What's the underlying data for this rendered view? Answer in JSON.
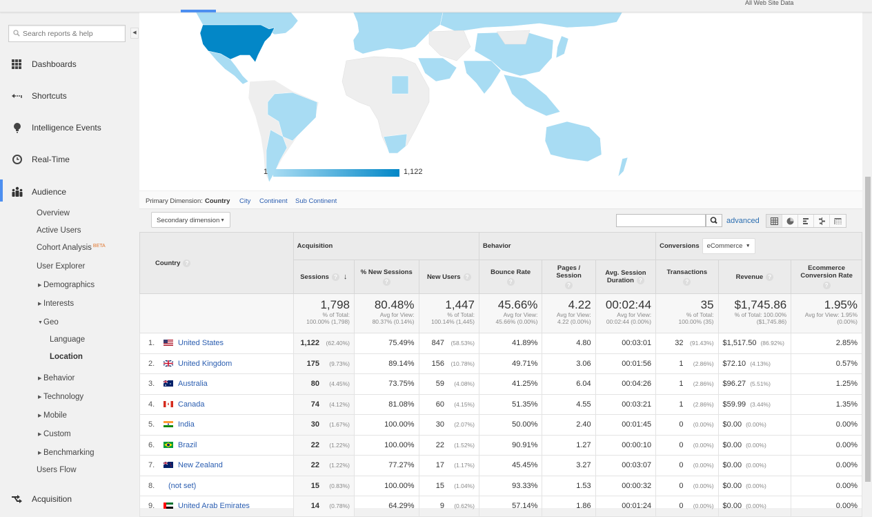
{
  "header": {
    "view_name": "All Web Site Data"
  },
  "sidebar": {
    "search_placeholder": "Search reports & help",
    "main_items": [
      {
        "label": "Dashboards",
        "icon": "grid-icon"
      },
      {
        "label": "Shortcuts",
        "icon": "shortcut-arrow-icon"
      },
      {
        "label": "Intelligence Events",
        "icon": "lightbulb-icon"
      },
      {
        "label": "Real-Time",
        "icon": "clock-icon"
      },
      {
        "label": "Audience",
        "icon": "people-icon",
        "active": true
      },
      {
        "label": "Acquisition",
        "icon": "acquisition-arrows-icon"
      }
    ],
    "audience_items": [
      {
        "label": "Overview"
      },
      {
        "label": "Active Users"
      },
      {
        "label": "Cohort Analysis",
        "badge": "BETA"
      },
      {
        "label": "User Explorer"
      },
      {
        "label": "Demographics",
        "caret": "right"
      },
      {
        "label": "Interests",
        "caret": "right"
      },
      {
        "label": "Geo",
        "caret": "down"
      },
      {
        "label": "Language",
        "level": 2
      },
      {
        "label": "Location",
        "level": 2,
        "selected": true
      },
      {
        "label": "Behavior",
        "caret": "right"
      },
      {
        "label": "Technology",
        "caret": "right"
      },
      {
        "label": "Mobile",
        "caret": "right"
      },
      {
        "label": "Custom",
        "caret": "right"
      },
      {
        "label": "Benchmarking",
        "caret": "right"
      },
      {
        "label": "Users Flow"
      }
    ]
  },
  "map": {
    "legend_min": "1",
    "legend_max": "1,122",
    "color_low": "#a8dcf3",
    "color_high": "#0387c7"
  },
  "primary_dimension": {
    "label": "Primary Dimension:",
    "current": "Country",
    "options": [
      "City",
      "Continent",
      "Sub Continent"
    ]
  },
  "toolbar": {
    "secondary_dimension": "Secondary dimension",
    "filter_value": "",
    "advanced_label": "advanced",
    "view_buttons": [
      "table-view",
      "pie-view",
      "performance-view",
      "comparison-view",
      "pivot-view"
    ]
  },
  "table": {
    "dimension_header": "Country",
    "groups": {
      "acquisition": "Acquisition",
      "behavior": "Behavior",
      "conversions": "Conversions",
      "conversions_select": "eCommerce"
    },
    "columns": [
      "Sessions",
      "% New Sessions",
      "New Users",
      "Bounce Rate",
      "Pages / Session",
      "Avg. Session Duration",
      "Transactions",
      "Revenue",
      "Ecommerce Conversion Rate"
    ],
    "totals": [
      {
        "value": "1,798",
        "sub1": "% of Total:",
        "sub2": "100.00% (1,798)"
      },
      {
        "value": "80.48%",
        "sub1": "Avg for View:",
        "sub2": "80.37% (0.14%)"
      },
      {
        "value": "1,447",
        "sub1": "% of Total:",
        "sub2": "100.14% (1,445)"
      },
      {
        "value": "45.66%",
        "sub1": "Avg for View:",
        "sub2": "45.66% (0.00%)"
      },
      {
        "value": "4.22",
        "sub1": "Avg for View:",
        "sub2": "4.22 (0.00%)"
      },
      {
        "value": "00:02:44",
        "sub1": "Avg for View:",
        "sub2": "00:02:44 (0.00%)"
      },
      {
        "value": "35",
        "sub1": "% of Total:",
        "sub2": "100.00% (35)"
      },
      {
        "value": "$1,745.86",
        "sub1": "% of Total: 100.00%",
        "sub2": "($1,745.86)"
      },
      {
        "value": "1.95%",
        "sub1": "Avg for View: 1.95%",
        "sub2": "(0.00%)"
      }
    ],
    "rows": [
      {
        "idx": "1.",
        "country": "United States",
        "flag": "us",
        "sessions": "1,122",
        "sessions_pct": "(62.40%)",
        "new_sessions": "75.49%",
        "new_users": "847",
        "new_users_pct": "(58.53%)",
        "bounce": "41.89%",
        "pages": "4.80",
        "duration": "00:03:01",
        "transactions": "32",
        "transactions_pct": "(91.43%)",
        "revenue": "$1,517.50",
        "revenue_pct": "(86.92%)",
        "conv_rate": "2.85%"
      },
      {
        "idx": "2.",
        "country": "United Kingdom",
        "flag": "gb",
        "sessions": "175",
        "sessions_pct": "(9.73%)",
        "new_sessions": "89.14%",
        "new_users": "156",
        "new_users_pct": "(10.78%)",
        "bounce": "49.71%",
        "pages": "3.06",
        "duration": "00:01:56",
        "transactions": "1",
        "transactions_pct": "(2.86%)",
        "revenue": "$72.10",
        "revenue_pct": "(4.13%)",
        "conv_rate": "0.57%"
      },
      {
        "idx": "3.",
        "country": "Australia",
        "flag": "au",
        "sessions": "80",
        "sessions_pct": "(4.45%)",
        "new_sessions": "73.75%",
        "new_users": "59",
        "new_users_pct": "(4.08%)",
        "bounce": "41.25%",
        "pages": "6.04",
        "duration": "00:04:26",
        "transactions": "1",
        "transactions_pct": "(2.86%)",
        "revenue": "$96.27",
        "revenue_pct": "(5.51%)",
        "conv_rate": "1.25%"
      },
      {
        "idx": "4.",
        "country": "Canada",
        "flag": "ca",
        "sessions": "74",
        "sessions_pct": "(4.12%)",
        "new_sessions": "81.08%",
        "new_users": "60",
        "new_users_pct": "(4.15%)",
        "bounce": "51.35%",
        "pages": "4.55",
        "duration": "00:03:21",
        "transactions": "1",
        "transactions_pct": "(2.86%)",
        "revenue": "$59.99",
        "revenue_pct": "(3.44%)",
        "conv_rate": "1.35%"
      },
      {
        "idx": "5.",
        "country": "India",
        "flag": "in",
        "sessions": "30",
        "sessions_pct": "(1.67%)",
        "new_sessions": "100.00%",
        "new_users": "30",
        "new_users_pct": "(2.07%)",
        "bounce": "50.00%",
        "pages": "2.40",
        "duration": "00:01:45",
        "transactions": "0",
        "transactions_pct": "(0.00%)",
        "revenue": "$0.00",
        "revenue_pct": "(0.00%)",
        "conv_rate": "0.00%"
      },
      {
        "idx": "6.",
        "country": "Brazil",
        "flag": "br",
        "sessions": "22",
        "sessions_pct": "(1.22%)",
        "new_sessions": "100.00%",
        "new_users": "22",
        "new_users_pct": "(1.52%)",
        "bounce": "90.91%",
        "pages": "1.27",
        "duration": "00:00:10",
        "transactions": "0",
        "transactions_pct": "(0.00%)",
        "revenue": "$0.00",
        "revenue_pct": "(0.00%)",
        "conv_rate": "0.00%"
      },
      {
        "idx": "7.",
        "country": "New Zealand",
        "flag": "nz",
        "sessions": "22",
        "sessions_pct": "(1.22%)",
        "new_sessions": "77.27%",
        "new_users": "17",
        "new_users_pct": "(1.17%)",
        "bounce": "45.45%",
        "pages": "3.27",
        "duration": "00:03:07",
        "transactions": "0",
        "transactions_pct": "(0.00%)",
        "revenue": "$0.00",
        "revenue_pct": "(0.00%)",
        "conv_rate": "0.00%"
      },
      {
        "idx": "8.",
        "country": "(not set)",
        "flag": "",
        "sessions": "15",
        "sessions_pct": "(0.83%)",
        "new_sessions": "100.00%",
        "new_users": "15",
        "new_users_pct": "(1.04%)",
        "bounce": "93.33%",
        "pages": "1.53",
        "duration": "00:00:32",
        "transactions": "0",
        "transactions_pct": "(0.00%)",
        "revenue": "$0.00",
        "revenue_pct": "(0.00%)",
        "conv_rate": "0.00%"
      },
      {
        "idx": "9.",
        "country": "United Arab Emirates",
        "flag": "ae",
        "sessions": "14",
        "sessions_pct": "(0.78%)",
        "new_sessions": "64.29%",
        "new_users": "9",
        "new_users_pct": "(0.62%)",
        "bounce": "57.14%",
        "pages": "1.86",
        "duration": "00:01:24",
        "transactions": "0",
        "transactions_pct": "(0.00%)",
        "revenue": "$0.00",
        "revenue_pct": "(0.00%)",
        "conv_rate": "0.00%"
      }
    ]
  }
}
